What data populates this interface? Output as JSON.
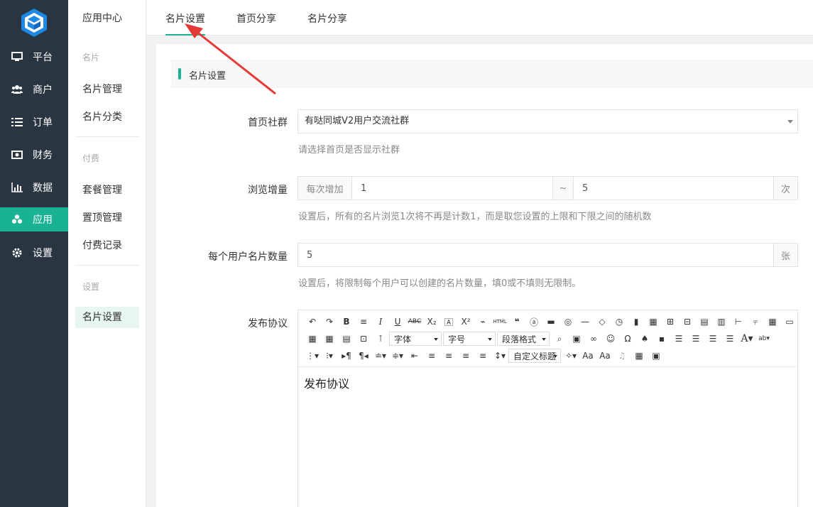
{
  "nav": {
    "items": [
      {
        "label": "平台",
        "icon": "monitor-icon"
      },
      {
        "label": "商户",
        "icon": "users-icon"
      },
      {
        "label": "订单",
        "icon": "list-icon"
      },
      {
        "label": "财务",
        "icon": "money-icon"
      },
      {
        "label": "数据",
        "icon": "bar-chart-icon"
      },
      {
        "label": "应用",
        "icon": "cubes-icon"
      },
      {
        "label": "设置",
        "icon": "gear-icon"
      }
    ]
  },
  "subnav": {
    "title": "应用中心",
    "group1": "名片",
    "item1": "名片管理",
    "item2": "名片分类",
    "group2": "付费",
    "item3": "套餐管理",
    "item4": "置顶管理",
    "item5": "付费记录",
    "group3": "设置",
    "item6": "名片设置"
  },
  "tabs": [
    "名片设置",
    "首页分享",
    "名片分享"
  ],
  "section": {
    "title": "名片设置"
  },
  "form": {
    "group_label": "首页社群",
    "group_value": "有哒同城V2用户交流社群",
    "group_hint": "请选择首页是否显示社群",
    "views_label": "浏览增量",
    "views_prefix": "每次增加",
    "views_min": "1",
    "views_sep": "~",
    "views_max": "5",
    "views_suffix": "次",
    "views_hint": "设置后，所有的名片浏览1次将不再是计数1，而是取您设置的上限和下限之间的随机数",
    "cards_label": "每个用户名片数量",
    "cards_value": "5",
    "cards_suffix": "张",
    "cards_hint": "设置后，将限制每个用户可以创建的名片数量，填0或不填则无限制。",
    "agreement_label": "发布协议"
  },
  "editor": {
    "font_family": "字体",
    "font_size": "字号",
    "paragraph": "段落格式",
    "custom_title": "自定义标题",
    "content": "发布协议"
  },
  "colors": {
    "accent": "#19b394",
    "sidebar": "#2a3542",
    "annotation": "#e53935"
  }
}
